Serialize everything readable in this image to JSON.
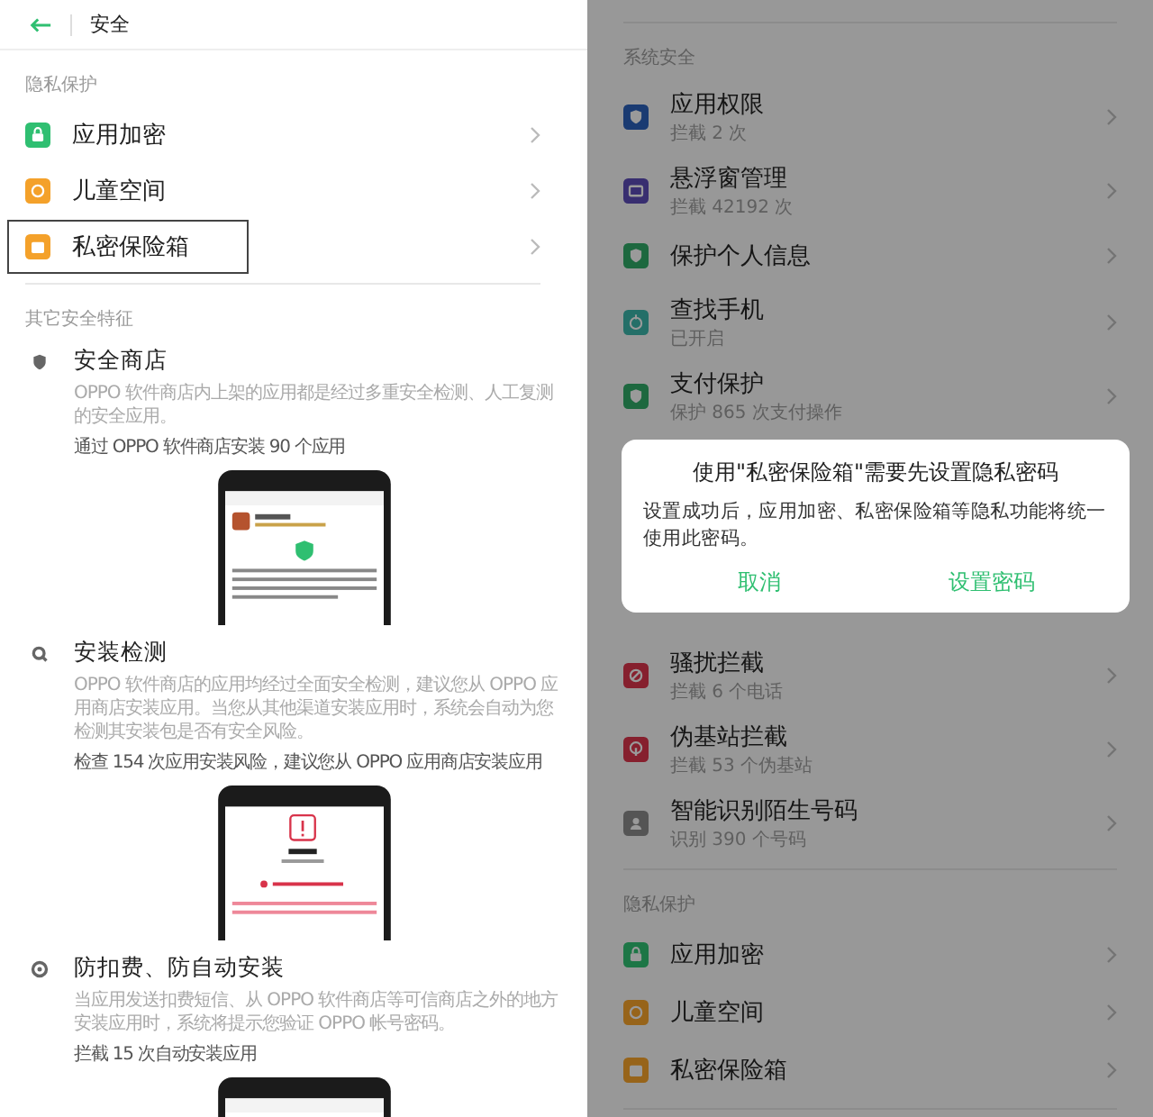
{
  "left": {
    "title": "安全",
    "privacy": {
      "label": "隐私保护",
      "items": [
        {
          "label": "应用加密",
          "color": "#2fbf71",
          "kind": "lock",
          "highlighted": false
        },
        {
          "label": "儿童空间",
          "color": "#f4a12a",
          "kind": "face",
          "highlighted": false
        },
        {
          "label": "私密保险箱",
          "color": "#f4a12a",
          "kind": "folder",
          "highlighted": true
        }
      ]
    },
    "features": {
      "label": "其它安全特征",
      "items": [
        {
          "title": "安全商店",
          "description": "OPPO 软件商店内上架的应用都是经过多重安全检测、人工复测的安全应用。",
          "stat": "通过 OPPO 软件商店安装 90 个应用",
          "kind": "review"
        },
        {
          "title": "安装检测",
          "description": "OPPO 软件商店的应用均经过全面安全检测，建议您从 OPPO 应用商店安装应用。当您从其他渠道安装应用时，系统会自动为您检测其安装包是否有安全风险。",
          "stat": "检查 154 次应用安装风险，建议您从 OPPO 应用商店安装应用",
          "kind": "warning"
        },
        {
          "title": "防扣费、防自动安装",
          "description": "当应用发送扣费短信、从 OPPO 软件商店等可信商店之外的地方安装应用时，系统将提示您验证 OPPO 帐号密码。",
          "stat": "拦截 15 次自动安装应用",
          "kind": "blank"
        }
      ]
    }
  },
  "right": {
    "system": {
      "label": "系统安全",
      "items": [
        {
          "label": "应用权限",
          "sub": "拦截 2 次",
          "color": "#1a3b72",
          "kind": "shield"
        },
        {
          "label": "悬浮窗管理",
          "sub": "拦截 42192 次",
          "color": "#382e70",
          "kind": "window"
        },
        {
          "label": "保护个人信息",
          "color": "#1d683f",
          "kind": "shield"
        },
        {
          "label": "查找手机",
          "sub": "已开启",
          "color": "#246f68",
          "kind": "clock"
        },
        {
          "label": "支付保护",
          "sub": "保护 865 次支付操作",
          "color": "#1d683f",
          "kind": "shield"
        }
      ]
    },
    "more_items": [
      {
        "label": "骚扰拦截",
        "sub": "拦截 6 个电话",
        "color": "#86202e",
        "kind": "block"
      },
      {
        "label": "伪基站拦截",
        "sub": "拦截 53 个伪基站",
        "color": "#86202e",
        "kind": "antenna"
      },
      {
        "label": "智能识别陌生号码",
        "sub": "识别 390 个号码",
        "color": "#555555",
        "kind": "person"
      }
    ],
    "privacy": {
      "label": "隐私保护",
      "items": [
        {
          "label": "应用加密",
          "color": "#1d7646",
          "kind": "lock"
        },
        {
          "label": "儿童空间",
          "color": "#97641a",
          "kind": "face"
        },
        {
          "label": "私密保险箱",
          "color": "#97641a",
          "kind": "folder"
        }
      ]
    },
    "dialog": {
      "title": "使用\"私密保险箱\"需要先设置隐私密码",
      "message": "设置成功后，应用加密、私密保险箱等隐私功能将统一使用此密码。",
      "buttons": [
        {
          "label": "取消"
        },
        {
          "label": "设置密码"
        }
      ]
    }
  }
}
